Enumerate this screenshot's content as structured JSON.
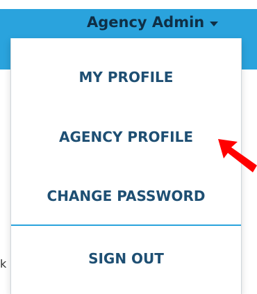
{
  "header": {
    "user_menu_label": "Agency Admin",
    "caret_icon": "chevron-down-icon",
    "bar_color": "#2aa3dd"
  },
  "dropdown": {
    "items": [
      {
        "label": "MY PROFILE"
      },
      {
        "label": "AGENCY PROFILE"
      },
      {
        "label": "CHANGE PASSWORD"
      },
      {
        "label": "SIGN OUT"
      }
    ],
    "divider_color": "#2aa3dd"
  },
  "background": {
    "partial_left_text": "k"
  },
  "annotation": {
    "arrow_color": "#ff0000"
  }
}
